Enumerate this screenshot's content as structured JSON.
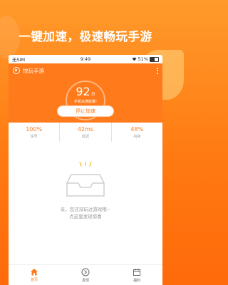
{
  "promo": {
    "title": "一键加速，极速畅玩手游"
  },
  "status": {
    "carrier": "无SIM",
    "time": "9:49",
    "battery": "51%"
  },
  "app": {
    "title": "快玩手游"
  },
  "score": {
    "value": "92",
    "unit": "分",
    "desc": "手机充满能量!"
  },
  "actions": {
    "stop": "停止加速"
  },
  "stats": [
    {
      "value": "100%",
      "label": "信号"
    },
    {
      "value": "42ms",
      "label": "延迟"
    },
    {
      "value": "48%",
      "label": "内存"
    }
  ],
  "empty": {
    "line1": "亲，您还没玩过游戏哦~",
    "line2": "点这里发现惊喜"
  },
  "tabs": [
    {
      "label": "首页",
      "icon": "home-icon"
    },
    {
      "label": "发现",
      "icon": "discover-icon"
    },
    {
      "label": "福利",
      "icon": "gift-icon"
    }
  ],
  "colors": {
    "accent": "#ff7a1a"
  }
}
